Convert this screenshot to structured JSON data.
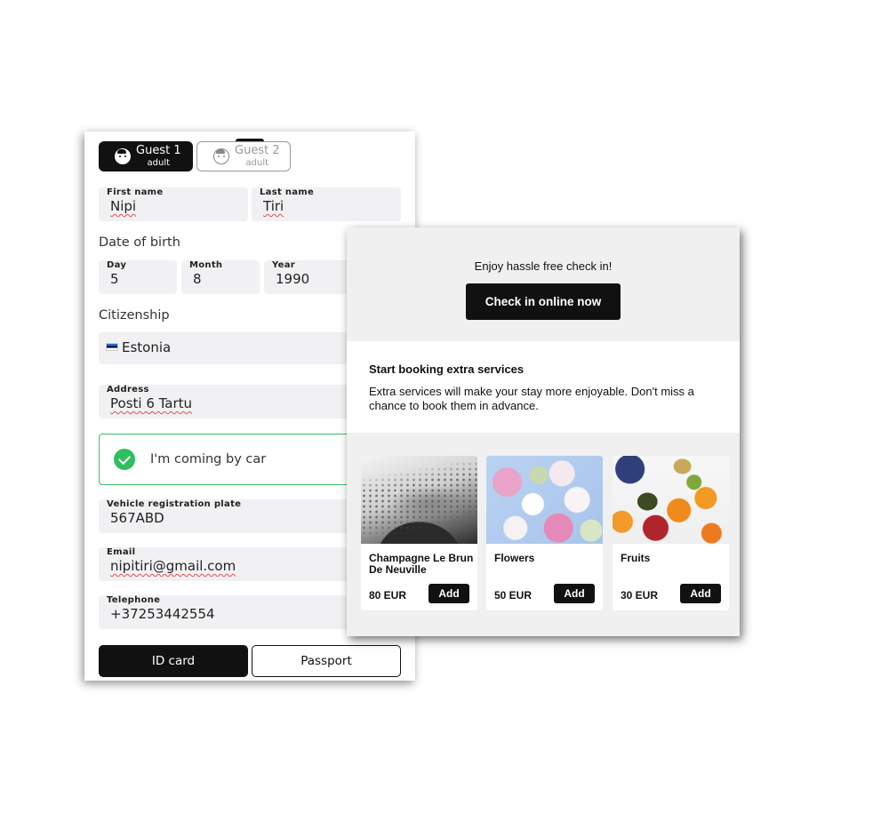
{
  "guests": [
    {
      "name": "Guest 1",
      "type": "adult"
    },
    {
      "name": "Guest 2",
      "type": "adult"
    }
  ],
  "form": {
    "first_name_label": "First name",
    "first_name_value": "Nipi",
    "last_name_label": "Last name",
    "last_name_value": "Tiri",
    "dob_section": "Date of birth",
    "day_label": "Day",
    "day_value": "5",
    "month_label": "Month",
    "month_value": "8",
    "year_label": "Year",
    "year_value": "1990",
    "citizenship_section": "Citizenship",
    "citizenship_value": "Estonia",
    "address_label": "Address",
    "address_value": "Posti 6 Tartu",
    "car_label": "I'm coming by car",
    "car_checked": true,
    "plate_label": "Vehicle registration plate",
    "plate_value": "567ABD",
    "email_label": "Email",
    "email_value": "nipitiri@gmail.com",
    "phone_label": "Telephone",
    "phone_value": "+37253442554",
    "doc_id_label": "ID card",
    "doc_passport_label": "Passport"
  },
  "checkin": {
    "text": "Enjoy hassle free check in!",
    "button_label": "Check in online now"
  },
  "extras": {
    "title": "Start booking extra services",
    "description": "Extra services will make your stay more enjoyable. Don't miss a chance to book them in advance.",
    "products": [
      {
        "name": "Champagne Le Brun De Neuville",
        "price": "80 EUR",
        "add_label": "Add"
      },
      {
        "name": "Flowers",
        "price": "50 EUR",
        "add_label": "Add"
      },
      {
        "name": "Fruits",
        "price": "30 EUR",
        "add_label": "Add"
      }
    ]
  },
  "colors": {
    "accent": "#111111",
    "success": "#2fbf5d",
    "field_bg": "#f1f1f3",
    "panel_bg": "#f0f0f1"
  }
}
